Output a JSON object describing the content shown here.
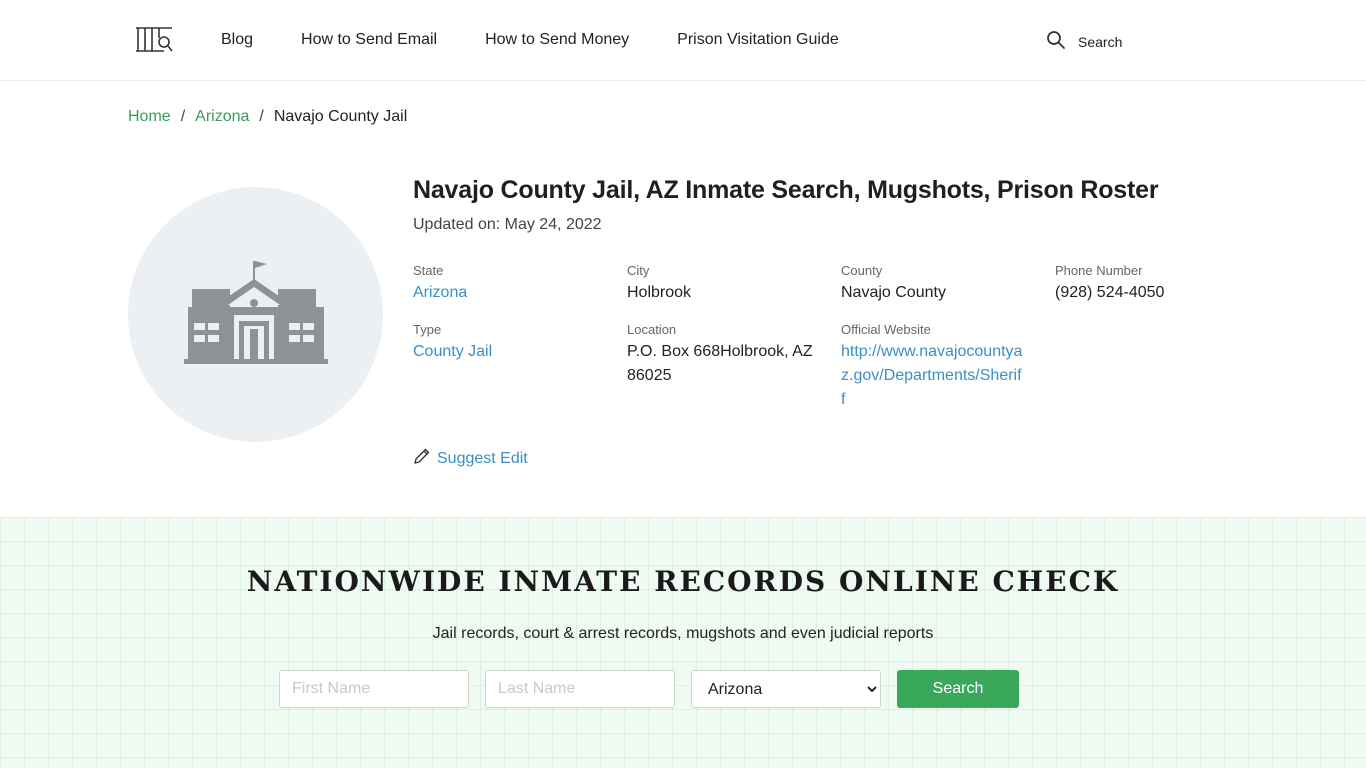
{
  "header": {
    "logo_icon": "prison-bars-magnifier-logo",
    "nav": [
      {
        "label": "Blog"
      },
      {
        "label": "How to Send Email"
      },
      {
        "label": "How to Send Money"
      },
      {
        "label": "Prison Visitation Guide"
      }
    ],
    "search_label": "Search",
    "search_icon": "search-icon"
  },
  "breadcrumb": {
    "home": "Home",
    "sep1": "/",
    "state": "Arizona",
    "sep2": "/",
    "current": "Navajo County Jail"
  },
  "facility": {
    "image_icon": "government-building-icon",
    "title": "Navajo County Jail, AZ Inmate Search, Mugshots, Prison Roster",
    "updated": "Updated on: May 24, 2022",
    "fields": {
      "state": {
        "label": "State",
        "value": "Arizona"
      },
      "city": {
        "label": "City",
        "value": "Holbrook"
      },
      "county": {
        "label": "County",
        "value": "Navajo County"
      },
      "phone": {
        "label": "Phone Number",
        "value": "(928) 524-4050"
      },
      "type": {
        "label": "Type",
        "value": "County Jail"
      },
      "location": {
        "label": "Location",
        "value": "P.O. Box 668Holbrook, AZ 86025"
      },
      "website": {
        "label": "Official Website",
        "value": "http://www.navajocountyaz.gov/Departments/Sheriff"
      }
    },
    "suggest_edit": "Suggest Edit",
    "suggest_icon": "pencil-icon"
  },
  "records_search": {
    "title": "NATIONWIDE INMATE RECORDS ONLINE CHECK",
    "subtitle": "Jail records, court & arrest records, mugshots and even judicial reports",
    "first_name_placeholder": "First Name",
    "last_name_placeholder": "Last Name",
    "state_selected": "Arizona",
    "button_label": "Search"
  },
  "colors": {
    "link_green": "#3a9a5b",
    "link_blue": "#3a8fc6",
    "button_green": "#3aa85b",
    "band_bg": "#effaf3"
  }
}
